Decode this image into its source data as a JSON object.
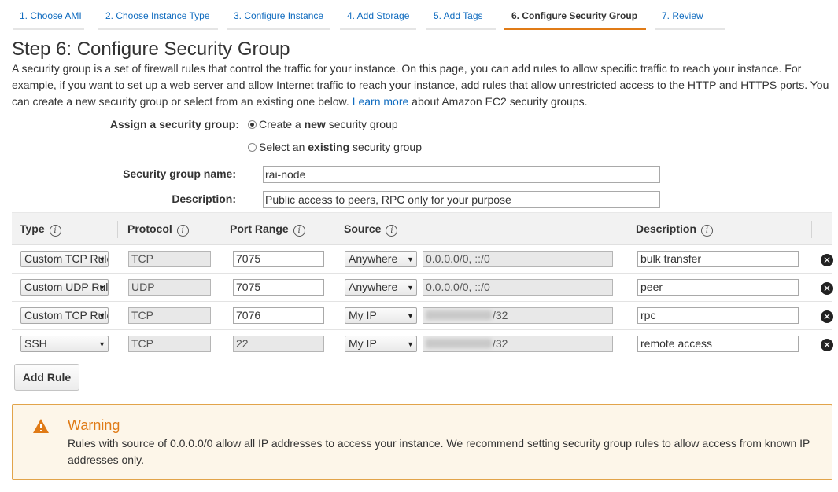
{
  "wizard": {
    "tabs": [
      {
        "label": "1. Choose AMI"
      },
      {
        "label": "2. Choose Instance Type"
      },
      {
        "label": "3. Configure Instance"
      },
      {
        "label": "4. Add Storage"
      },
      {
        "label": "5. Add Tags"
      },
      {
        "label": "6. Configure Security Group"
      },
      {
        "label": "7. Review"
      }
    ],
    "active_index": 5
  },
  "page": {
    "title": "Step 6: Configure Security Group",
    "intro_text": "A security group is a set of firewall rules that control the traffic for your instance. On this page, you can add rules to allow specific traffic to reach your instance. For example, if you want to set up a web server and allow Internet traffic to reach your instance, add rules that allow unrestricted access to the HTTP and HTTPS ports. You can create a new security group or select from an existing one below.",
    "learn_more_label": "Learn more",
    "intro_suffix": "about Amazon EC2 security groups."
  },
  "assign": {
    "label": "Assign a security group:",
    "option_new": {
      "prefix": "Create a ",
      "bold": "new",
      "suffix": " security group",
      "checked": true
    },
    "option_existing": {
      "prefix": "Select an ",
      "bold": "existing",
      "suffix": " security group",
      "checked": false
    }
  },
  "group_name": {
    "label": "Security group name:",
    "value": "rai-node"
  },
  "group_description": {
    "label": "Description:",
    "value": "Public access to peers, RPC only for your purpose"
  },
  "table": {
    "headers": {
      "type": "Type",
      "protocol": "Protocol",
      "port_range": "Port Range",
      "source": "Source",
      "description": "Description"
    },
    "info_glyph": "i",
    "rows": [
      {
        "type": "Custom TCP Rule",
        "protocol": "TCP",
        "port": "7075",
        "source_type": "Anywhere",
        "source_value": "0.0.0.0/0, ::/0",
        "source_redacted": false,
        "description": "bulk transfer"
      },
      {
        "type": "Custom UDP Rule",
        "protocol": "UDP",
        "port": "7075",
        "source_type": "Anywhere",
        "source_value": "0.0.0.0/0, ::/0",
        "source_redacted": false,
        "description": "peer"
      },
      {
        "type": "Custom TCP Rule",
        "protocol": "TCP",
        "port": "7076",
        "source_type": "My IP",
        "source_value": "/32",
        "source_redacted": true,
        "description": "rpc"
      },
      {
        "type": "SSH",
        "protocol": "TCP",
        "port": "22",
        "source_type": "My IP",
        "source_value": "/32",
        "source_redacted": true,
        "description": "remote access"
      }
    ]
  },
  "add_rule_label": "Add Rule",
  "warning": {
    "title": "Warning",
    "body": "Rules with source of 0.0.0.0/0 allow all IP addresses to access your instance. We recommend setting security group rules to allow access from known IP addresses only.",
    "accent_color": "#e07b17"
  },
  "icons": {
    "delete": "close-circle-icon",
    "info": "info-icon",
    "warning": "warning-triangle-icon",
    "dropdown": "chevron-down-icon"
  },
  "colors": {
    "link": "#0f6bbf",
    "active_tab": "#e07b17",
    "warning_border": "#e2a44a"
  }
}
